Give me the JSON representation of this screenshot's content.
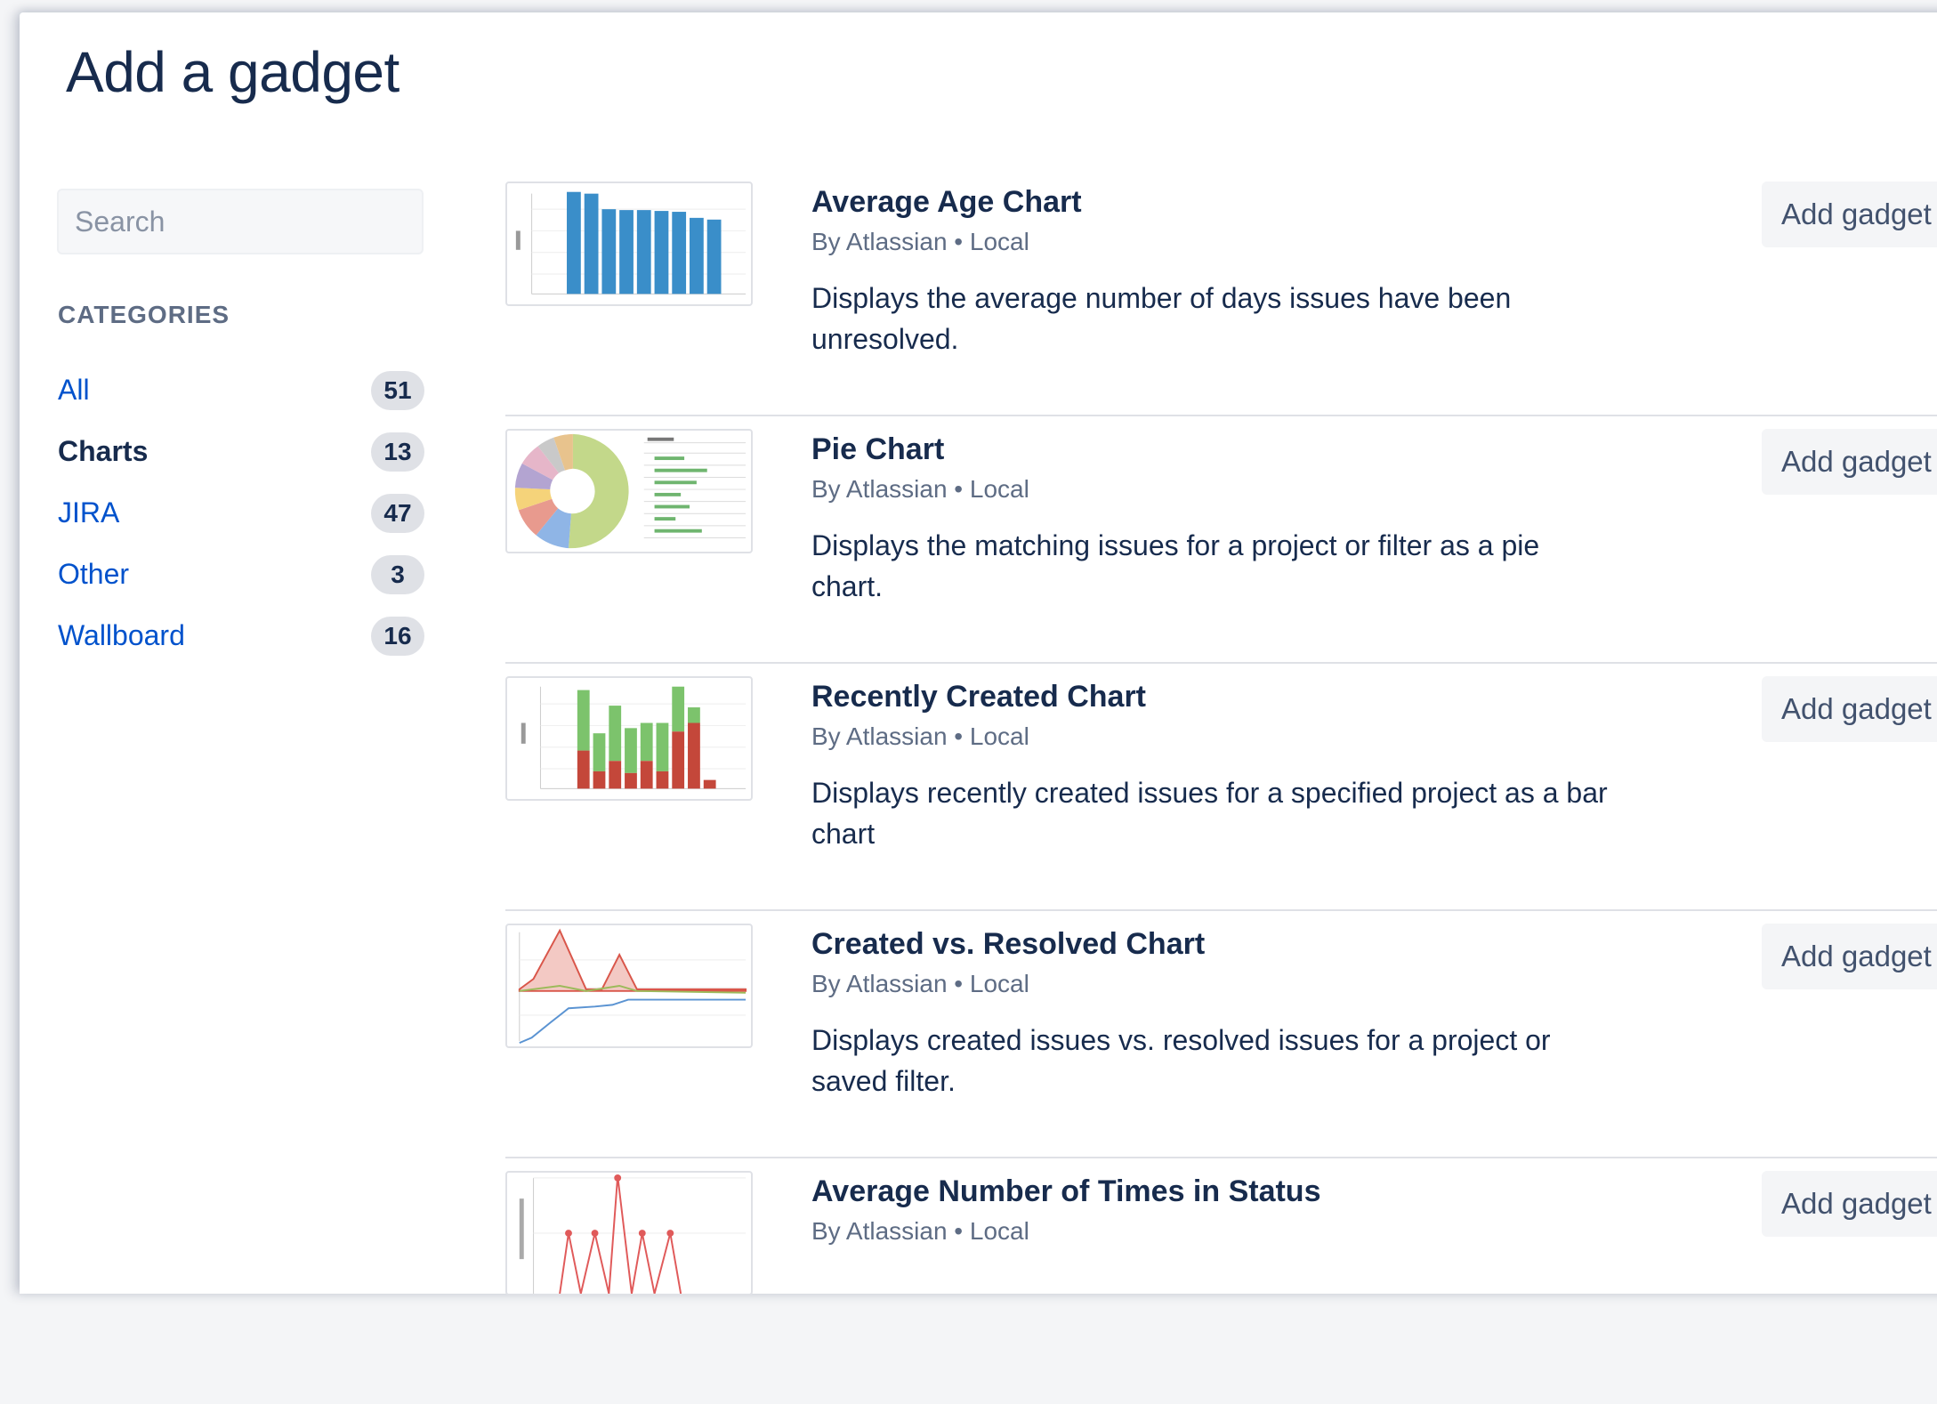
{
  "title": "Add a gadget",
  "search": {
    "placeholder": "Search",
    "value": ""
  },
  "categories": {
    "heading": "CATEGORIES",
    "items": [
      {
        "label": "All",
        "count": "51",
        "selected": false
      },
      {
        "label": "Charts",
        "count": "13",
        "selected": true
      },
      {
        "label": "JIRA",
        "count": "47",
        "selected": false
      },
      {
        "label": "Other",
        "count": "3",
        "selected": false
      },
      {
        "label": "Wallboard",
        "count": "16",
        "selected": false
      }
    ]
  },
  "gadgets": [
    {
      "title": "Average Age Chart",
      "meta": "By Atlassian • Local",
      "description": "Displays the average number of days issues have been unresolved.",
      "button": "Add gadget",
      "thumbnail": "bar-chart-thumbnail"
    },
    {
      "title": "Pie Chart",
      "meta": "By Atlassian • Local",
      "description": "Displays the matching issues for a project or filter as a pie chart.",
      "button": "Add gadget",
      "thumbnail": "pie-chart-thumbnail"
    },
    {
      "title": "Recently Created Chart",
      "meta": "By Atlassian • Local",
      "description": "Displays recently created issues for a specified project as a bar chart",
      "button": "Add gadget",
      "thumbnail": "stacked-bar-chart-thumbnail"
    },
    {
      "title": "Created vs. Resolved Chart",
      "meta": "By Atlassian • Local",
      "description": "Displays created issues vs. resolved issues for a project or saved filter.",
      "button": "Add gadget",
      "thumbnail": "area-line-chart-thumbnail"
    },
    {
      "title": "Average Number of Times in Status",
      "meta": "By Atlassian • Local",
      "description": "",
      "button": "Add gadget",
      "thumbnail": "line-chart-thumbnail"
    }
  ]
}
